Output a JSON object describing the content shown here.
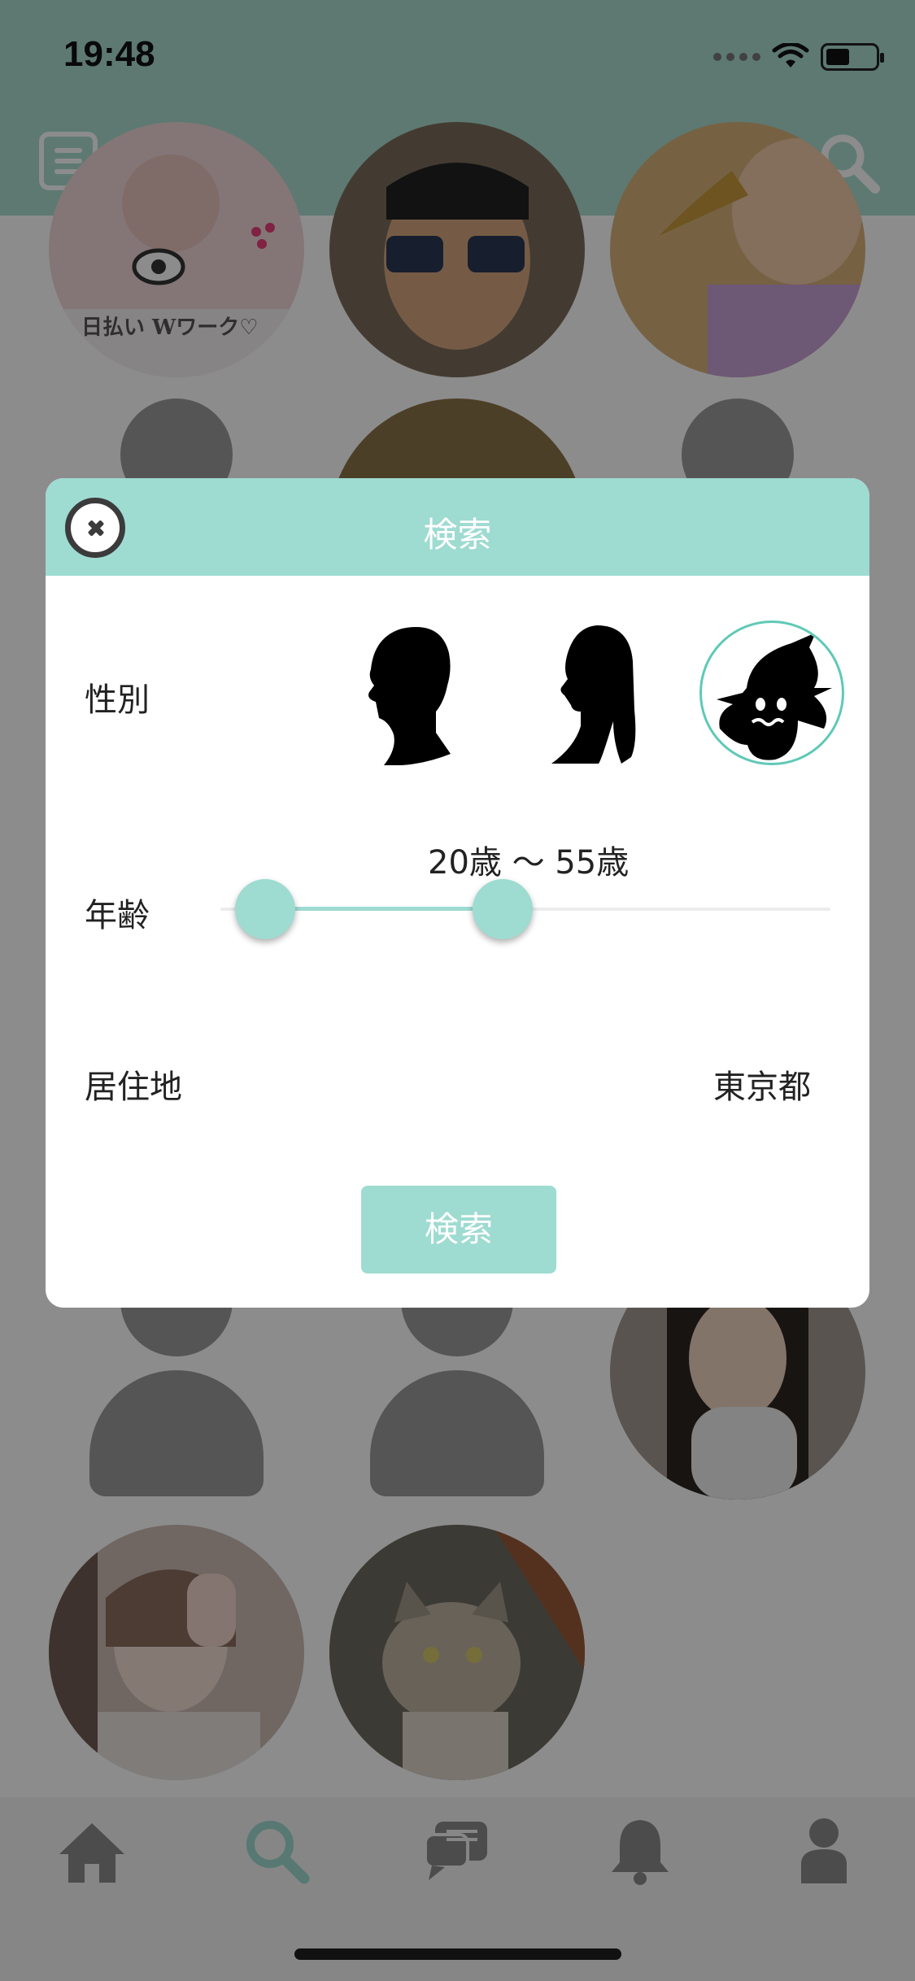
{
  "status_bar": {
    "time": "19:48"
  },
  "nav": {
    "title": "検索"
  },
  "grid": {
    "thumbs": [
      {
        "kind": "photo",
        "caption": "日払い Wワーク♡",
        "color": "#f1d8d8"
      },
      {
        "kind": "photo",
        "color": "#7b6c5a"
      },
      {
        "kind": "photo",
        "color": "#d7b27a"
      },
      {
        "kind": "silhouette"
      },
      {
        "kind": "photo",
        "color": "#8a7348"
      },
      {
        "kind": "silhouette"
      },
      {
        "kind": "silhouette"
      },
      {
        "kind": "silhouette"
      },
      {
        "kind": "photo",
        "color": "#a59a92"
      },
      {
        "kind": "photo",
        "color": "#cdbab3"
      },
      {
        "kind": "photo",
        "color": "#8b8679"
      }
    ]
  },
  "modal": {
    "title": "検索",
    "gender_label": "性別",
    "age_label": "年齢",
    "age_value": "20歳 〜 55歳",
    "residence_label": "居住地",
    "residence_value": "東京都",
    "search_button": "検索"
  },
  "tabbar": {
    "tabs": [
      {
        "icon": "home-icon",
        "active": false
      },
      {
        "icon": "search-icon",
        "active": true
      },
      {
        "icon": "chat-icon",
        "active": false
      },
      {
        "icon": "bell-icon",
        "active": false
      },
      {
        "icon": "person-icon",
        "active": false
      }
    ]
  },
  "colors": {
    "accent": "#9edbd1",
    "header_dimmed": "#6b7d78"
  }
}
